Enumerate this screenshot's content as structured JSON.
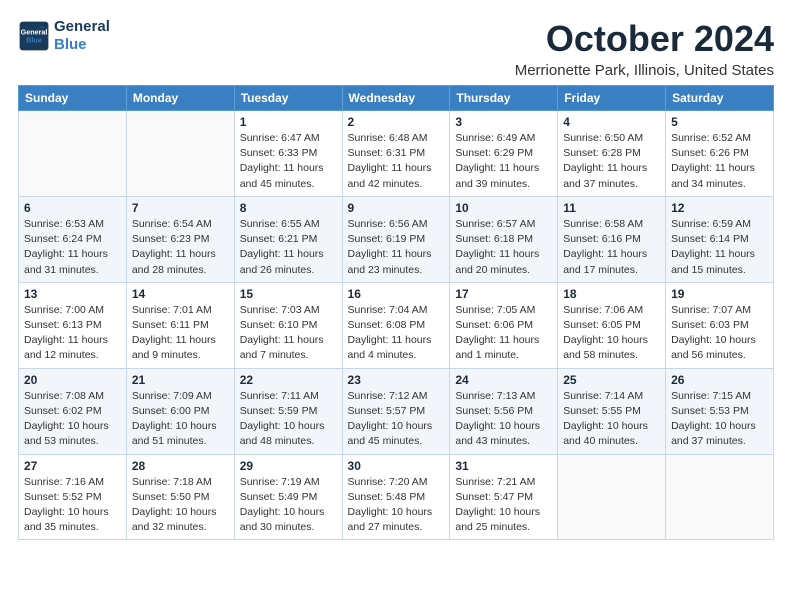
{
  "header": {
    "logo_line1": "General",
    "logo_line2": "Blue",
    "month": "October 2024",
    "location": "Merrionette Park, Illinois, United States"
  },
  "columns": [
    "Sunday",
    "Monday",
    "Tuesday",
    "Wednesday",
    "Thursday",
    "Friday",
    "Saturday"
  ],
  "weeks": [
    [
      {
        "day": "",
        "detail": ""
      },
      {
        "day": "",
        "detail": ""
      },
      {
        "day": "1",
        "detail": "Sunrise: 6:47 AM\nSunset: 6:33 PM\nDaylight: 11 hours and 45 minutes."
      },
      {
        "day": "2",
        "detail": "Sunrise: 6:48 AM\nSunset: 6:31 PM\nDaylight: 11 hours and 42 minutes."
      },
      {
        "day": "3",
        "detail": "Sunrise: 6:49 AM\nSunset: 6:29 PM\nDaylight: 11 hours and 39 minutes."
      },
      {
        "day": "4",
        "detail": "Sunrise: 6:50 AM\nSunset: 6:28 PM\nDaylight: 11 hours and 37 minutes."
      },
      {
        "day": "5",
        "detail": "Sunrise: 6:52 AM\nSunset: 6:26 PM\nDaylight: 11 hours and 34 minutes."
      }
    ],
    [
      {
        "day": "6",
        "detail": "Sunrise: 6:53 AM\nSunset: 6:24 PM\nDaylight: 11 hours and 31 minutes."
      },
      {
        "day": "7",
        "detail": "Sunrise: 6:54 AM\nSunset: 6:23 PM\nDaylight: 11 hours and 28 minutes."
      },
      {
        "day": "8",
        "detail": "Sunrise: 6:55 AM\nSunset: 6:21 PM\nDaylight: 11 hours and 26 minutes."
      },
      {
        "day": "9",
        "detail": "Sunrise: 6:56 AM\nSunset: 6:19 PM\nDaylight: 11 hours and 23 minutes."
      },
      {
        "day": "10",
        "detail": "Sunrise: 6:57 AM\nSunset: 6:18 PM\nDaylight: 11 hours and 20 minutes."
      },
      {
        "day": "11",
        "detail": "Sunrise: 6:58 AM\nSunset: 6:16 PM\nDaylight: 11 hours and 17 minutes."
      },
      {
        "day": "12",
        "detail": "Sunrise: 6:59 AM\nSunset: 6:14 PM\nDaylight: 11 hours and 15 minutes."
      }
    ],
    [
      {
        "day": "13",
        "detail": "Sunrise: 7:00 AM\nSunset: 6:13 PM\nDaylight: 11 hours and 12 minutes."
      },
      {
        "day": "14",
        "detail": "Sunrise: 7:01 AM\nSunset: 6:11 PM\nDaylight: 11 hours and 9 minutes."
      },
      {
        "day": "15",
        "detail": "Sunrise: 7:03 AM\nSunset: 6:10 PM\nDaylight: 11 hours and 7 minutes."
      },
      {
        "day": "16",
        "detail": "Sunrise: 7:04 AM\nSunset: 6:08 PM\nDaylight: 11 hours and 4 minutes."
      },
      {
        "day": "17",
        "detail": "Sunrise: 7:05 AM\nSunset: 6:06 PM\nDaylight: 11 hours and 1 minute."
      },
      {
        "day": "18",
        "detail": "Sunrise: 7:06 AM\nSunset: 6:05 PM\nDaylight: 10 hours and 58 minutes."
      },
      {
        "day": "19",
        "detail": "Sunrise: 7:07 AM\nSunset: 6:03 PM\nDaylight: 10 hours and 56 minutes."
      }
    ],
    [
      {
        "day": "20",
        "detail": "Sunrise: 7:08 AM\nSunset: 6:02 PM\nDaylight: 10 hours and 53 minutes."
      },
      {
        "day": "21",
        "detail": "Sunrise: 7:09 AM\nSunset: 6:00 PM\nDaylight: 10 hours and 51 minutes."
      },
      {
        "day": "22",
        "detail": "Sunrise: 7:11 AM\nSunset: 5:59 PM\nDaylight: 10 hours and 48 minutes."
      },
      {
        "day": "23",
        "detail": "Sunrise: 7:12 AM\nSunset: 5:57 PM\nDaylight: 10 hours and 45 minutes."
      },
      {
        "day": "24",
        "detail": "Sunrise: 7:13 AM\nSunset: 5:56 PM\nDaylight: 10 hours and 43 minutes."
      },
      {
        "day": "25",
        "detail": "Sunrise: 7:14 AM\nSunset: 5:55 PM\nDaylight: 10 hours and 40 minutes."
      },
      {
        "day": "26",
        "detail": "Sunrise: 7:15 AM\nSunset: 5:53 PM\nDaylight: 10 hours and 37 minutes."
      }
    ],
    [
      {
        "day": "27",
        "detail": "Sunrise: 7:16 AM\nSunset: 5:52 PM\nDaylight: 10 hours and 35 minutes."
      },
      {
        "day": "28",
        "detail": "Sunrise: 7:18 AM\nSunset: 5:50 PM\nDaylight: 10 hours and 32 minutes."
      },
      {
        "day": "29",
        "detail": "Sunrise: 7:19 AM\nSunset: 5:49 PM\nDaylight: 10 hours and 30 minutes."
      },
      {
        "day": "30",
        "detail": "Sunrise: 7:20 AM\nSunset: 5:48 PM\nDaylight: 10 hours and 27 minutes."
      },
      {
        "day": "31",
        "detail": "Sunrise: 7:21 AM\nSunset: 5:47 PM\nDaylight: 10 hours and 25 minutes."
      },
      {
        "day": "",
        "detail": ""
      },
      {
        "day": "",
        "detail": ""
      }
    ]
  ]
}
